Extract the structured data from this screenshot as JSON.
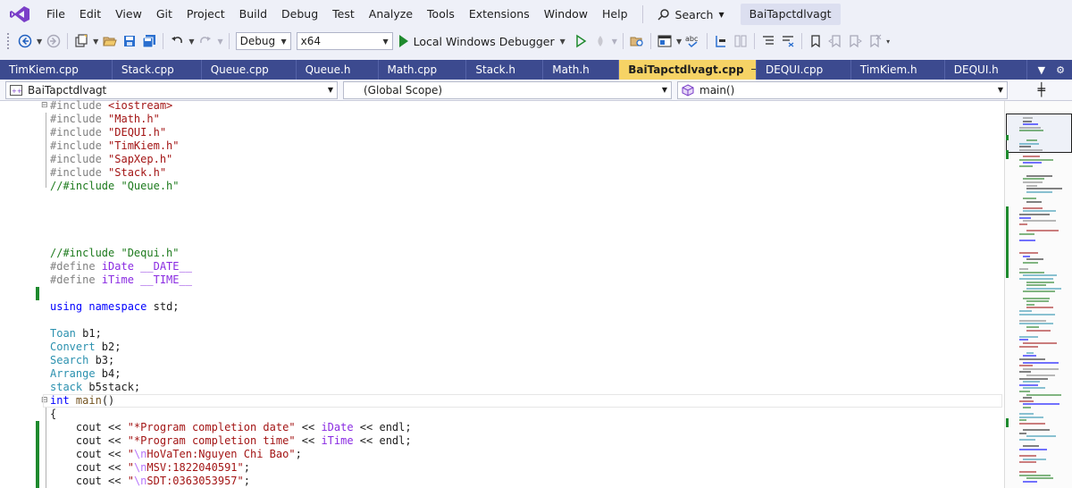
{
  "menubar": {
    "items": [
      "File",
      "Edit",
      "View",
      "Git",
      "Project",
      "Build",
      "Debug",
      "Test",
      "Analyze",
      "Tools",
      "Extensions",
      "Window",
      "Help"
    ],
    "search_label": "Search",
    "solution_name": "BaiTapctdlvagt"
  },
  "toolbar": {
    "config": "Debug",
    "platform": "x64",
    "run_label": "Local Windows Debugger"
  },
  "tabs": [
    {
      "label": "TimKiem.cpp",
      "active": false
    },
    {
      "label": "Stack.cpp",
      "active": false
    },
    {
      "label": "Queue.cpp",
      "active": false
    },
    {
      "label": "Queue.h",
      "active": false
    },
    {
      "label": "Math.cpp",
      "active": false
    },
    {
      "label": "Stack.h",
      "active": false
    },
    {
      "label": "Math.h",
      "active": false
    },
    {
      "label": "BaiTapctdlvagt.cpp",
      "active": true
    },
    {
      "label": "DEQUI.cpp",
      "active": false
    },
    {
      "label": "TimKiem.h",
      "active": false
    },
    {
      "label": "DEQUI.h",
      "active": false
    }
  ],
  "navbar": {
    "project": "BaiTapctdlvagt",
    "scope": "(Global Scope)",
    "member": "main()"
  },
  "code": {
    "l1": {
      "a": "#include ",
      "b": "<iostream>"
    },
    "l2": {
      "a": "#include ",
      "b": "\"Math.h\""
    },
    "l3": {
      "a": "#include ",
      "b": "\"DEQUI.h\""
    },
    "l4": {
      "a": "#include ",
      "b": "\"TimKiem.h\""
    },
    "l5": {
      "a": "#include ",
      "b": "\"SapXep.h\""
    },
    "l6": {
      "a": "#include ",
      "b": "\"Stack.h\""
    },
    "l7": {
      "a": "//#include \"Queue.h\""
    },
    "l12": {
      "a": "//#include \"Dequi.h\""
    },
    "l13": {
      "a": "#define ",
      "b": "iDate",
      "c": " __DATE__"
    },
    "l14": {
      "a": "#define ",
      "b": "iTime",
      "c": " __TIME__"
    },
    "l16": {
      "a": "using",
      "b": " ",
      "c": "namespace",
      "d": " std;"
    },
    "l18": {
      "a": "Toan",
      "b": " b1;"
    },
    "l19": {
      "a": "Convert",
      "b": " b2;"
    },
    "l20": {
      "a": "Search",
      "b": " b3;"
    },
    "l21": {
      "a": "Arrange",
      "b": " b4;"
    },
    "l22": {
      "a": "stack",
      "b": " b5stack;"
    },
    "l23": {
      "a": "int",
      "b": " ",
      "c": "main",
      "d": "()"
    },
    "l24": {
      "a": "{"
    },
    "l25": {
      "a": "    cout << ",
      "b": "\"*Program completion date\"",
      "c": " << ",
      "d": "iDate",
      "e": " << endl;"
    },
    "l26": {
      "a": "    cout << ",
      "b": "\"*Program completion time\"",
      "c": " << ",
      "d": "iTime",
      "e": " << endl;"
    },
    "l27": {
      "a": "    cout << ",
      "b": "\"",
      "c": "\\n",
      "d": "HoVaTen:Nguyen Chi Bao\"",
      "e": ";"
    },
    "l28": {
      "a": "    cout << ",
      "b": "\"",
      "c": "\\n",
      "d": "MSV:1822040591\"",
      "e": ";"
    },
    "l29": {
      "a": "    cout << ",
      "b": "\"",
      "c": "\\n",
      "d": "SDT:0363053957\"",
      "e": ";"
    }
  }
}
